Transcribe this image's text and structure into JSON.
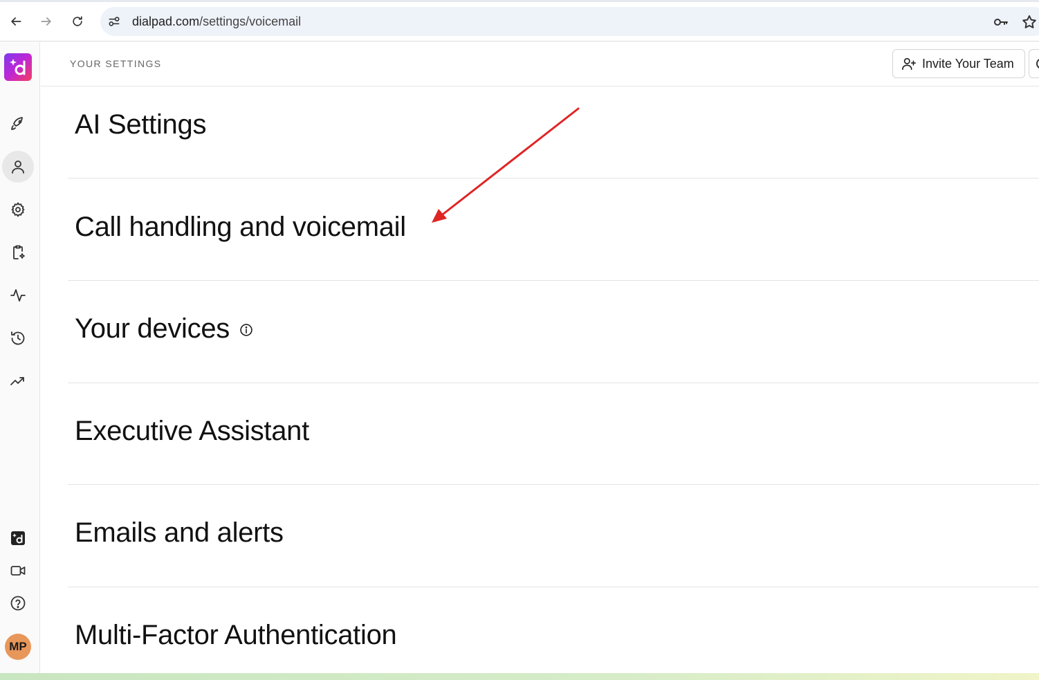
{
  "browser": {
    "url_host": "dialpad.com",
    "url_path": "/settings/voicemail"
  },
  "header": {
    "eyebrow": "YOUR SETTINGS",
    "invite_label": "Invite Your Team"
  },
  "rail": {
    "avatar_initials": "MP"
  },
  "sections": [
    {
      "title": "AI Settings"
    },
    {
      "title": "Call handling and voicemail"
    },
    {
      "title": "Your devices"
    },
    {
      "title": "Executive Assistant"
    },
    {
      "title": "Emails and alerts"
    },
    {
      "title": "Multi-Factor Authentication"
    }
  ],
  "colors": {
    "annotation_arrow": "#e02424",
    "avatar_bg": "#e8975a"
  }
}
